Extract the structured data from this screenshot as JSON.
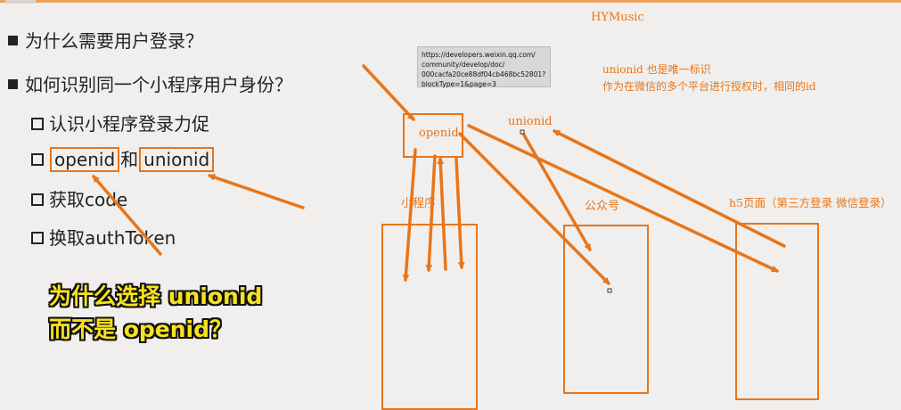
{
  "app": {
    "title": "HYMusic"
  },
  "slide": {
    "bullets": [
      "为什么需要用户登录？",
      "如何识别同一个小程序用户身份？"
    ],
    "sub_items": {
      "item1": "认识小程序登录力促",
      "item2_a": "openid",
      "item2_b": "和",
      "item2_c": "unionid",
      "item3": "获取code",
      "item4": "换取authToken"
    },
    "caption": [
      "为什么选择 unionid",
      "而不是 openid？"
    ]
  },
  "tooltip": {
    "lines": [
      "https://developers.weixin.qq.com/",
      "community/develop/doc/",
      "000cacfa20ce88df04cb468bc52801?",
      "blockType=1&page=3"
    ]
  },
  "diagram": {
    "openid_label": "openid",
    "unionid_label": "unionid",
    "note_line1": "unionid 也是唯一标识",
    "note_line2": "作为在微信的多个平台进行授权时，相同的id",
    "platform_miniprogram": "小程序",
    "platform_official": "公众号",
    "platform_h5": "h5页面（第三方登录 微信登录）"
  },
  "colors": {
    "accent": "#e8751a",
    "caption_fill": "#f7e21e",
    "background": "#f0efed"
  }
}
